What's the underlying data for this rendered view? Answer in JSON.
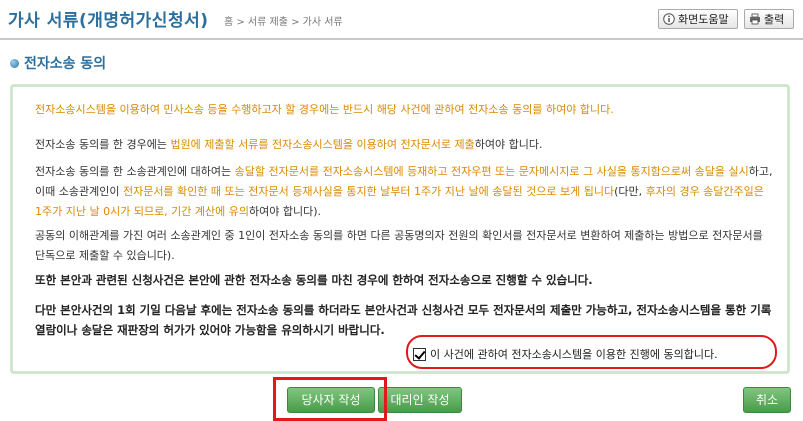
{
  "header": {
    "title": "가사 서류(개명허가신청서)",
    "breadcrumb": "홈 > 서류 제출 > 가사 서류",
    "help_label": "화면도움말",
    "print_label": "출력"
  },
  "section": {
    "title": "전자소송 동의"
  },
  "content": {
    "p1": "전자소송시스템을 이용하여 민사소송 등을 수행하고자 할 경우에는 반드시 해당 사건에 관하여 전자소송 동의를 하여야 합니다.",
    "p2_a": "전자소송 동의를 한 경우에는 ",
    "p2_b": "법원에 제출할 서류를 전자소송시스템을 이용하여 전자문서로 제출",
    "p2_c": "하여야 합니다.",
    "p3_a": "전자소송 동의를 한 소송관계인에 대하여는 ",
    "p3_b": "송달할 전자문서를 전자소송시스템에 등재하고 전자우편 또는 문자메시지로 그 사실을 통지함으로써 송달을 실시",
    "p3_c": "하고, 이때 소송관계인이 ",
    "p3_d": "전자문서를 확인한 때 또는 전자문서 등재사실을 통지한 날부터 1주가 지난 날에 송달된 것으로 보게 됩니다",
    "p3_e": "(다만, ",
    "p3_f": "후자의 경우 송달간주일은 1주가 지난 날 0시가 되므로, 기간 계산에 유의",
    "p3_g": "하여야 합니다).",
    "p4": "공동의 이해관계를 가진 여러 소송관계인 중 1인이 전자소송 동의를 하면 다른 공동명의자 전원의 확인서를 전자문서로 변환하여 제출하는 방법으로 전자문서를 단독으로 제출할 수 있습니다).",
    "p5": "또한 본안과 관련된 신청사건은 본안에 관한 전자소송 동의를 마친 경우에 한하여 전자소송으로 진행할 수 있습니다.",
    "p6": "다만 본안사건의 1회 기일 다음날 후에는 전자소송 동의를 하더라도 본안사건과 신청사건 모두 전자문서의 제출만 가능하고, 전자소송시스템을 통한 기록열람이나 송달은 재판장의 허가가 있어야 가능함을 유의하시기 바랍니다."
  },
  "agree": {
    "label": "이 사건에 관하여 전자소송시스템을 이용한 진행에 동의합니다.",
    "checked": true
  },
  "buttons": {
    "party": "당사자 작성",
    "agent": "대리인 작성",
    "cancel": "취소"
  },
  "colors": {
    "title_blue": "#2a6f9e",
    "highlight_orange": "#d98a00",
    "button_green": "#4a9a4a",
    "annotation_red": "#e01a1a"
  },
  "icons": {
    "help": "info-circle-icon",
    "print": "printer-icon",
    "bullet": "circle-bullet-icon"
  }
}
